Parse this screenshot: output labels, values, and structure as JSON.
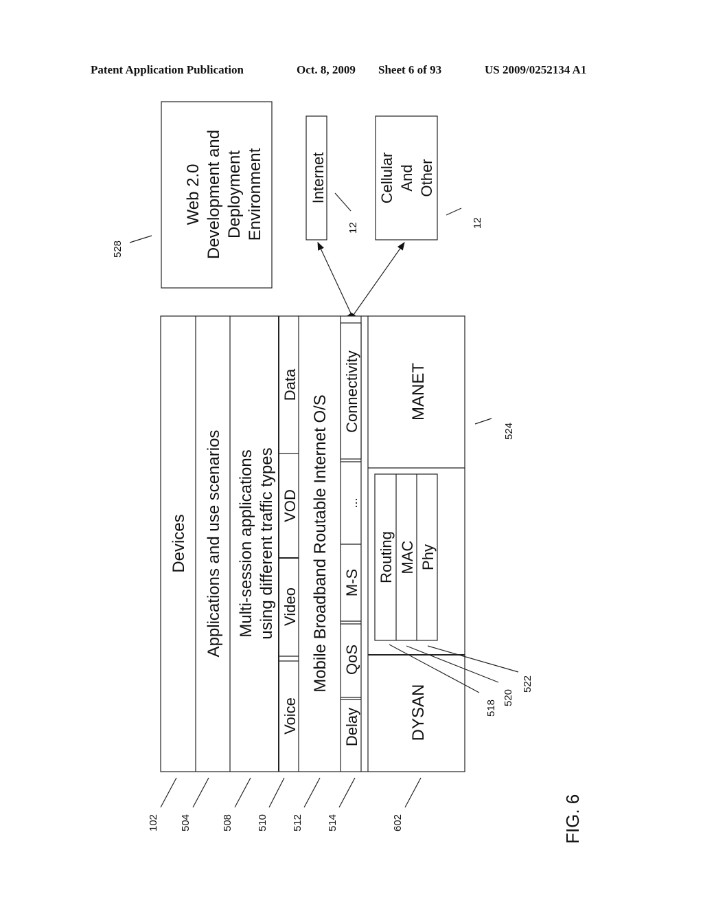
{
  "header": {
    "publication": "Patent Application Publication",
    "date": "Oct. 8, 2009",
    "sheet": "Sheet 6 of 93",
    "number": "US 2009/0252134 A1"
  },
  "figure": {
    "label": "FIG. 6"
  },
  "web_box": {
    "lines": [
      "Web 2.0",
      "Development and",
      "Deployment",
      "Environment"
    ],
    "ref": "528"
  },
  "internet_box": {
    "label": "Internet",
    "ref": "12"
  },
  "cellular_box": {
    "lines": [
      "Cellular",
      "And",
      "Other"
    ],
    "ref": "12"
  },
  "stack": {
    "devices": {
      "label": "Devices",
      "ref": "102"
    },
    "applications": {
      "label": "Applications and use scenarios",
      "ref": "504"
    },
    "multisession": {
      "lines": [
        "Multi-session applications",
        "using different traffic types"
      ],
      "ref": "508"
    },
    "traffic": {
      "ref": "510",
      "cells": [
        "Voice",
        "Video",
        "VOD",
        "Data"
      ]
    },
    "os": {
      "label": "Mobile Broadband Routable Internet O/S",
      "ref": "512"
    },
    "services": {
      "ref": "514",
      "cells": [
        "Delay",
        "QoS",
        "M-S",
        "...",
        "Connectivity"
      ]
    },
    "network": {
      "ref": "602",
      "dysan": "DYSAN",
      "manet": {
        "label": "MANET",
        "ref": "524"
      },
      "layers": [
        {
          "label": "Routing",
          "ref": "518"
        },
        {
          "label": "MAC",
          "ref": "520"
        },
        {
          "label": "Phy",
          "ref": "522"
        }
      ]
    }
  }
}
